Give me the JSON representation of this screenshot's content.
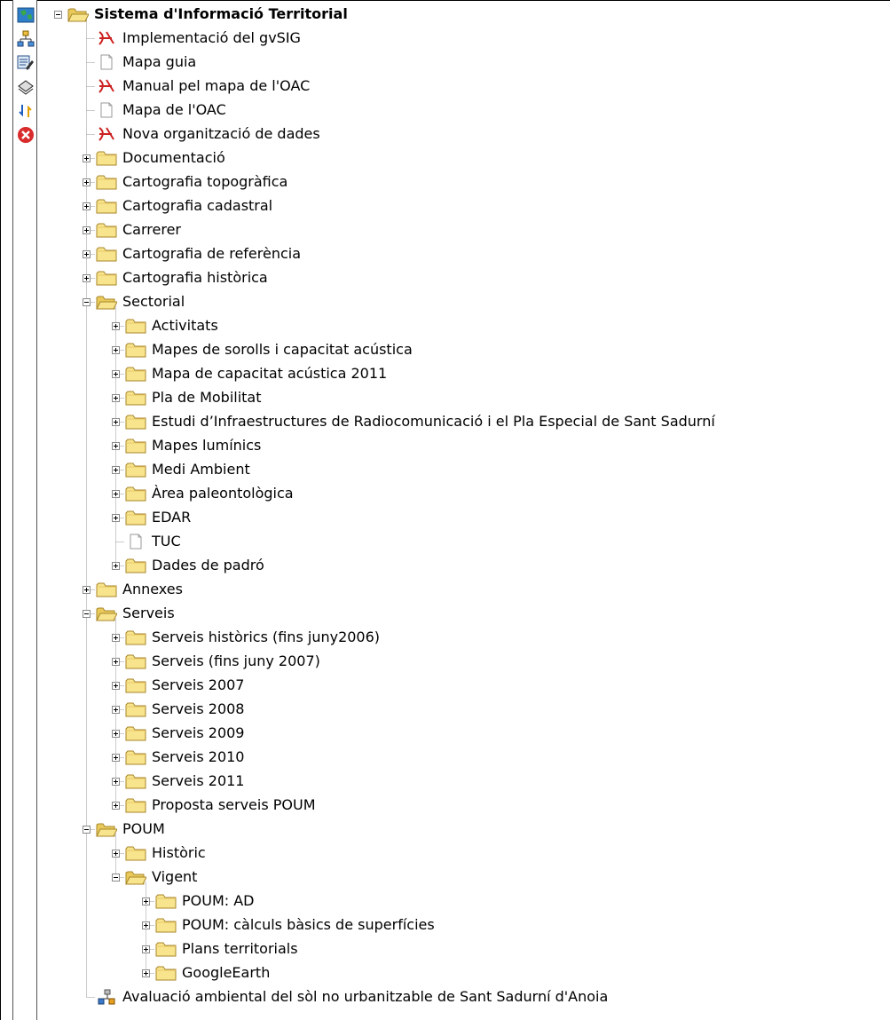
{
  "toolbar": {
    "buttons": [
      {
        "icon": "map-icon"
      },
      {
        "icon": "network-tree-icon"
      },
      {
        "icon": "edit-list-icon"
      },
      {
        "icon": "layers-icon"
      },
      {
        "icon": "arrows-icon"
      },
      {
        "icon": "close-red-icon"
      }
    ]
  },
  "tree": {
    "root_label": "Sistema d'Informació Territorial",
    "items": [
      {
        "label": "Implementació del gvSIG",
        "type": "pdf",
        "depth": 1
      },
      {
        "label": "Mapa guia",
        "type": "file",
        "depth": 1
      },
      {
        "label": "Manual pel mapa de l'OAC",
        "type": "pdf",
        "depth": 1
      },
      {
        "label": "Mapa de l'OAC",
        "type": "file",
        "depth": 1
      },
      {
        "label": "Nova organització de dades",
        "type": "pdf",
        "depth": 1
      },
      {
        "label": "Documentació",
        "type": "folder",
        "depth": 1
      },
      {
        "label": "Cartografia topogràfica",
        "type": "folder",
        "depth": 1
      },
      {
        "label": "Cartografia cadastral",
        "type": "folder",
        "depth": 1
      },
      {
        "label": "Carrerer",
        "type": "folder",
        "depth": 1
      },
      {
        "label": "Cartografia de referència",
        "type": "folder",
        "depth": 1
      },
      {
        "label": "Cartografia històrica",
        "type": "folder",
        "depth": 1
      },
      {
        "label": "Sectorial",
        "type": "folder-open",
        "depth": 1
      },
      {
        "label": "Activitats",
        "type": "folder",
        "depth": 2
      },
      {
        "label": "Mapes de sorolls i capacitat acústica",
        "type": "folder",
        "depth": 2
      },
      {
        "label": "Mapa de capacitat acústica 2011",
        "type": "folder",
        "depth": 2
      },
      {
        "label": "Pla de Mobilitat",
        "type": "folder",
        "depth": 2
      },
      {
        "label": "Estudi d’Infraestructures de Radiocomunicació i el Pla Especial de Sant Sadurní",
        "type": "folder",
        "depth": 2
      },
      {
        "label": "Mapes lumínics",
        "type": "folder",
        "depth": 2
      },
      {
        "label": "Medi Ambient",
        "type": "folder",
        "depth": 2
      },
      {
        "label": "Àrea paleontològica",
        "type": "folder",
        "depth": 2
      },
      {
        "label": "EDAR",
        "type": "folder",
        "depth": 2
      },
      {
        "label": "TUC",
        "type": "file",
        "depth": 2
      },
      {
        "label": "Dades de padró",
        "type": "folder",
        "depth": 2
      },
      {
        "label": "Annexes",
        "type": "folder",
        "depth": 1
      },
      {
        "label": "Serveis",
        "type": "folder-open",
        "depth": 1
      },
      {
        "label": "Serveis històrics (fins juny2006)",
        "type": "folder",
        "depth": 2
      },
      {
        "label": "Serveis (fins juny 2007)",
        "type": "folder",
        "depth": 2
      },
      {
        "label": "Serveis 2007",
        "type": "folder",
        "depth": 2
      },
      {
        "label": "Serveis 2008",
        "type": "folder",
        "depth": 2
      },
      {
        "label": "Serveis 2009",
        "type": "folder",
        "depth": 2
      },
      {
        "label": "Serveis 2010",
        "type": "folder",
        "depth": 2
      },
      {
        "label": "Serveis 2011",
        "type": "folder",
        "depth": 2
      },
      {
        "label": "Proposta serveis POUM",
        "type": "folder",
        "depth": 2
      },
      {
        "label": "POUM",
        "type": "folder-open",
        "depth": 1
      },
      {
        "label": "Històric",
        "type": "folder",
        "depth": 2
      },
      {
        "label": "Vigent",
        "type": "folder-open",
        "depth": 2
      },
      {
        "label": "POUM: AD",
        "type": "folder",
        "depth": 3
      },
      {
        "label": "POUM: càlculs bàsics de superfícies",
        "type": "folder",
        "depth": 3
      },
      {
        "label": "Plans territorials",
        "type": "folder",
        "depth": 3
      },
      {
        "label": "GoogleEarth",
        "type": "folder",
        "depth": 3
      },
      {
        "label": "Avaluació ambiental del sòl no urbanitzable de Sant Sadurní d'Anoia",
        "type": "network",
        "depth": 1
      }
    ]
  },
  "colors": {
    "folder_fill": "#f7e48c",
    "folder_stroke": "#a8862a",
    "pdf_red": "#cc2222",
    "guide": "#9a9a9a"
  }
}
